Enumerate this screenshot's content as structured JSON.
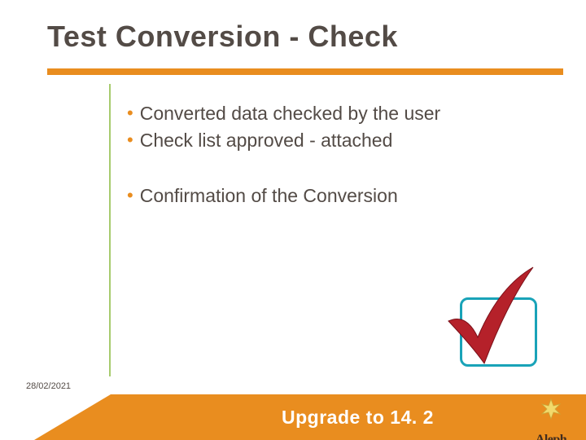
{
  "title": "Test Conversion - Check",
  "bullets": {
    "b1": "Converted data checked by the user",
    "b2": "Check list approved - attached",
    "b3": "Confirmation of the Conversion"
  },
  "footer": {
    "text": "Upgrade to 14. 2"
  },
  "date": "28/02/2021",
  "logo": {
    "text": "Aleph"
  },
  "colors": {
    "accent": "#e98d1f",
    "rule": "#a7cb6e",
    "text": "#534b46",
    "check_box": "#19a3b8",
    "check_mark": "#b5212a"
  }
}
